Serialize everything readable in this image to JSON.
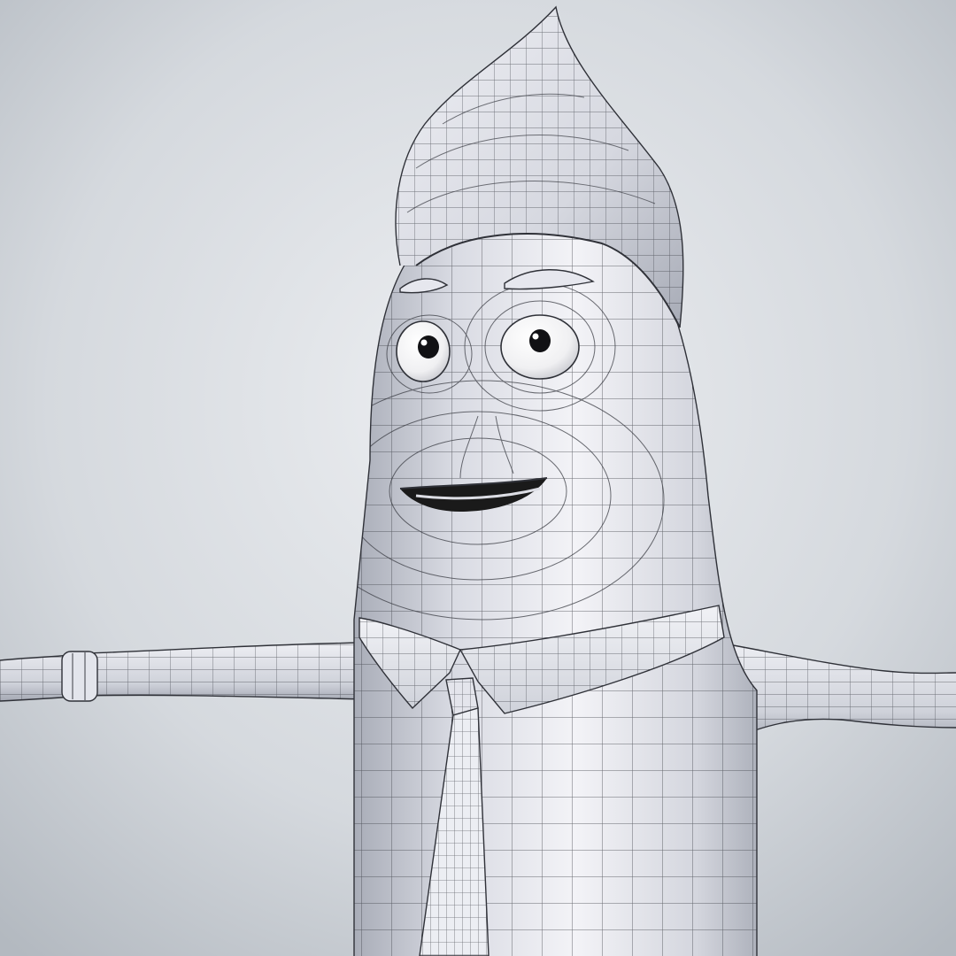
{
  "scene": {
    "subject": "wireframe-cartoon-character",
    "colors": {
      "background_light": "#e6e9ec",
      "background_mid": "#d2d6db",
      "background_dark": "#a9b0b7",
      "body_light": "#f2f2f6",
      "body_mid": "#d7d9e1",
      "body_dark": "#9ea2ad",
      "wire": "#3b3d44",
      "eye_white": "#fafafa",
      "pupil": "#111114",
      "mouth": "#1a1a1a"
    }
  }
}
